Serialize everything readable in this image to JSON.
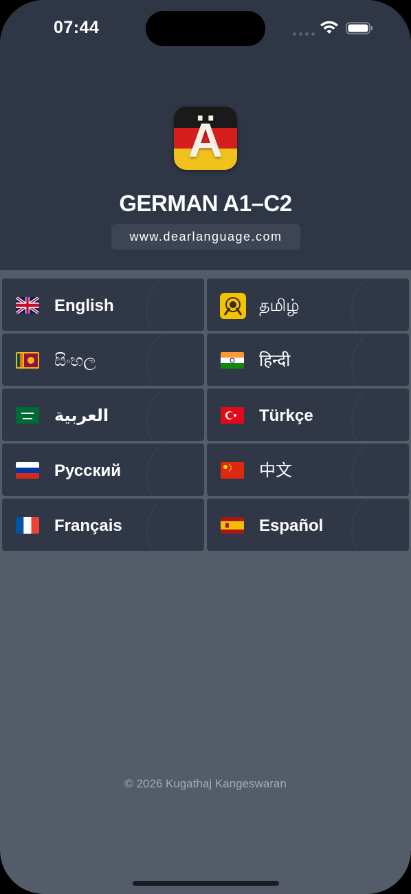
{
  "status_bar": {
    "time": "07:44",
    "icons": [
      "signal-icon",
      "wifi-icon",
      "battery-icon"
    ]
  },
  "header": {
    "app_icon_letter": "Ä",
    "title": "GERMAN A1–C2",
    "url": "www.dearlanguage.com"
  },
  "colors": {
    "header_bg": "#2f3646",
    "page_bg": "#545c69",
    "tile_bg": "#303747",
    "text": "#ffffff",
    "muted": "#a4abb6"
  },
  "languages": [
    {
      "label": "English",
      "flag": "uk-flag-icon"
    },
    {
      "label": "தமிழ்",
      "flag": "tamil-emblem-icon"
    },
    {
      "label": "සිංහල",
      "flag": "sri-lanka-flag-icon"
    },
    {
      "label": "हिन्दी",
      "flag": "india-flag-icon"
    },
    {
      "label": "العربية",
      "flag": "saudi-arabia-flag-icon"
    },
    {
      "label": "Türkçe",
      "flag": "turkey-flag-icon"
    },
    {
      "label": "Русский",
      "flag": "russia-flag-icon"
    },
    {
      "label": "中文",
      "flag": "china-flag-icon"
    },
    {
      "label": "Français",
      "flag": "france-flag-icon"
    },
    {
      "label": "Español",
      "flag": "spain-flag-icon"
    }
  ],
  "footer": {
    "copyright": "© 2026 Kugathaj Kangeswaran"
  }
}
